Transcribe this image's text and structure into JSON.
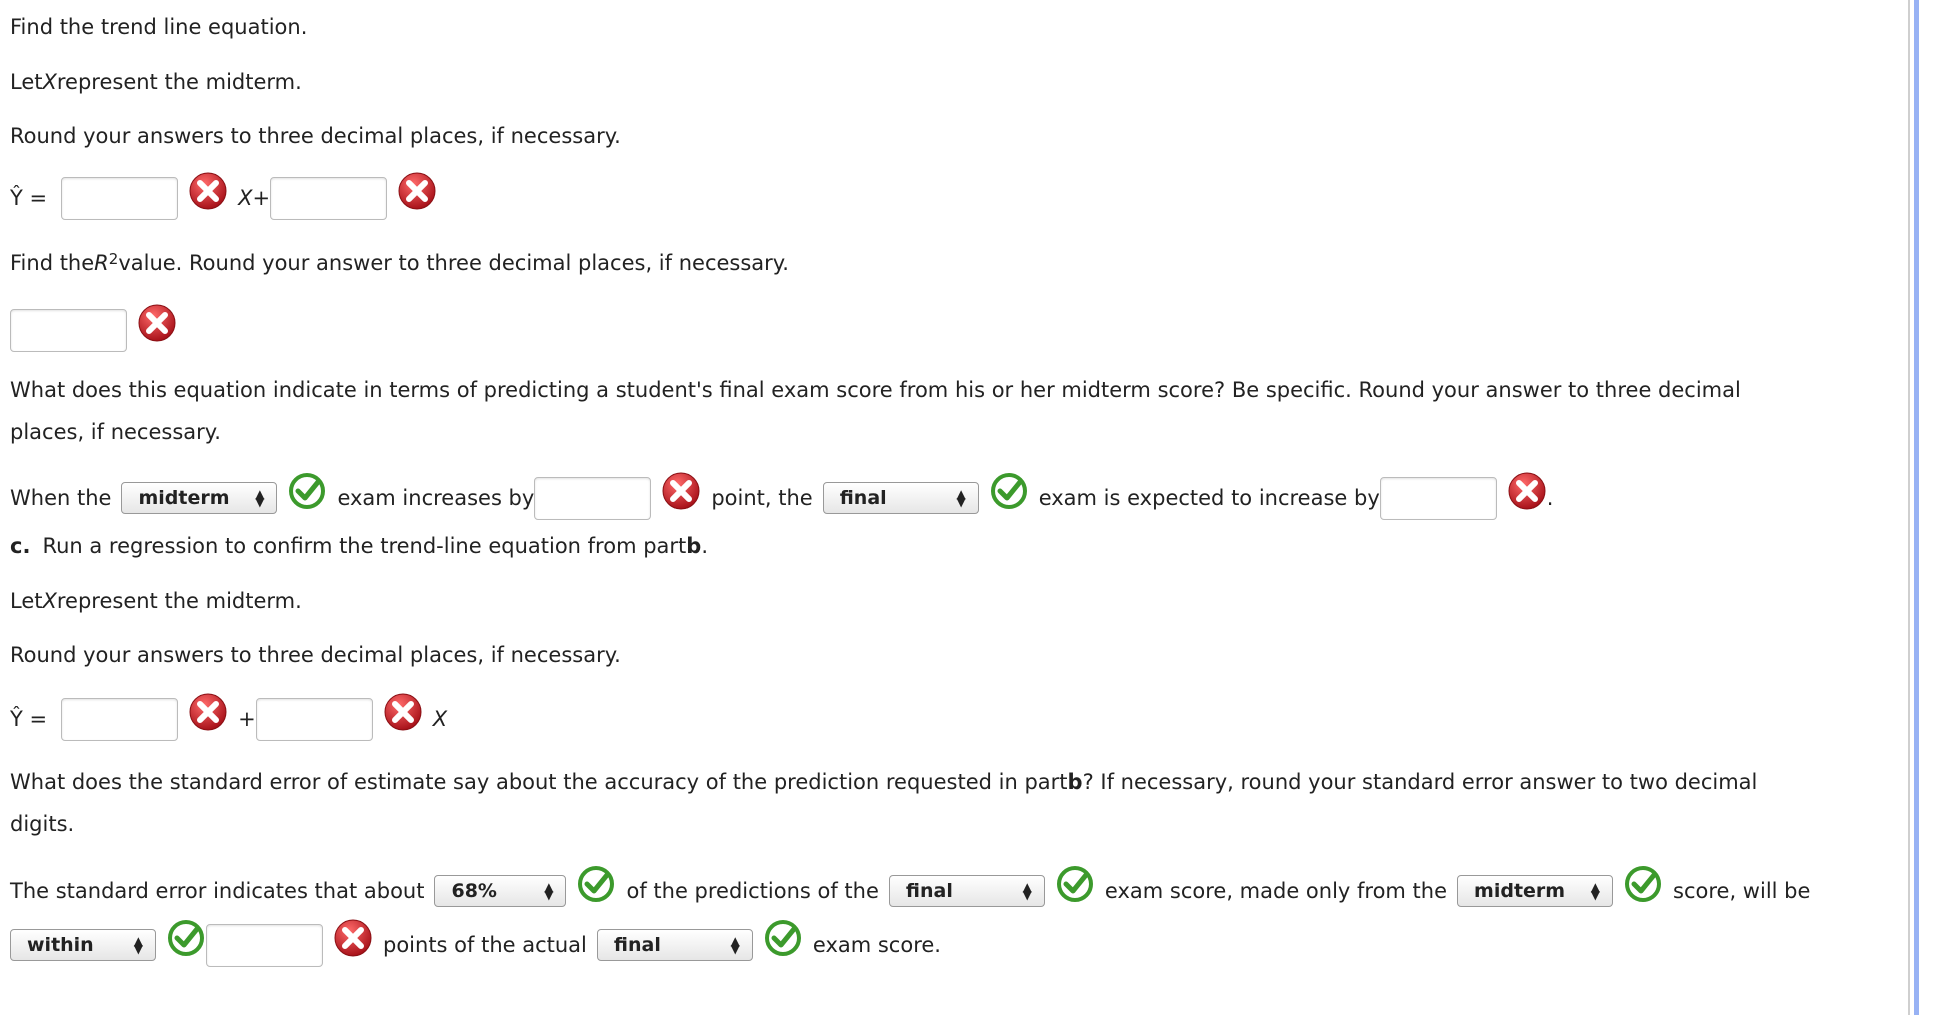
{
  "colors": {
    "error": "#c0262d",
    "correct": "#3c9a2c",
    "scrollbar": "#98b2f4"
  },
  "icons": {
    "wrong": "x-circle-icon",
    "right": "check-circle-icon"
  },
  "part_b": {
    "line1": "Find the trend line equation.",
    "line2_pre": "Let ",
    "line2_var": "X",
    "line2_post": " represent the midterm.",
    "line3": "Round your answers to three decimal places, if necessary.",
    "eq_lhs": "Ŷ =",
    "eq_mid_var": "X",
    "eq_mid_op": " +",
    "r2_pre": "Find the ",
    "r2_var": "R",
    "r2_sup": "2",
    "r2_post": " value. Round your answer to three decimal places, if necessary.",
    "interp_line1": "What does this equation indicate in terms of predicting a student's final exam score from his or her midterm score? Be specific. Round your answer to three decimal",
    "interp_line2": "places, if necessary.",
    "when_the": "When the",
    "select1": "midterm",
    "exam_increases_by": "exam increases by",
    "point_the": "point, the",
    "select2": "final",
    "expected": "exam is expected to increase by",
    "period": "."
  },
  "part_c": {
    "label": "c.",
    "text_pre": "Run a regression to confirm the trend-line equation from part ",
    "text_bold": "b",
    "text_post": ".",
    "line2_pre": "Let ",
    "line2_var": "X",
    "line2_post": " represent the midterm.",
    "line3": "Round your answers to three decimal places, if necessary.",
    "eq_lhs": "Ŷ =",
    "eq_op": "+",
    "eq_var": "X",
    "se_line1_pre": "What does the standard error of estimate say about the accuracy of the prediction requested in part ",
    "se_line1_bold": "b",
    "se_line1_post": "? If necessary, round your standard error answer to two decimal",
    "se_line2": "digits.",
    "se_a": "The standard error indicates that about",
    "select_pct": "68%",
    "se_b": "of the predictions of the",
    "select_final": "final",
    "se_c": "exam score, made only from the",
    "select_midterm": "midterm",
    "se_d": "score, will be",
    "select_within": "within",
    "se_e": "points of the actual",
    "select_final2": "final",
    "se_f": "exam score."
  }
}
